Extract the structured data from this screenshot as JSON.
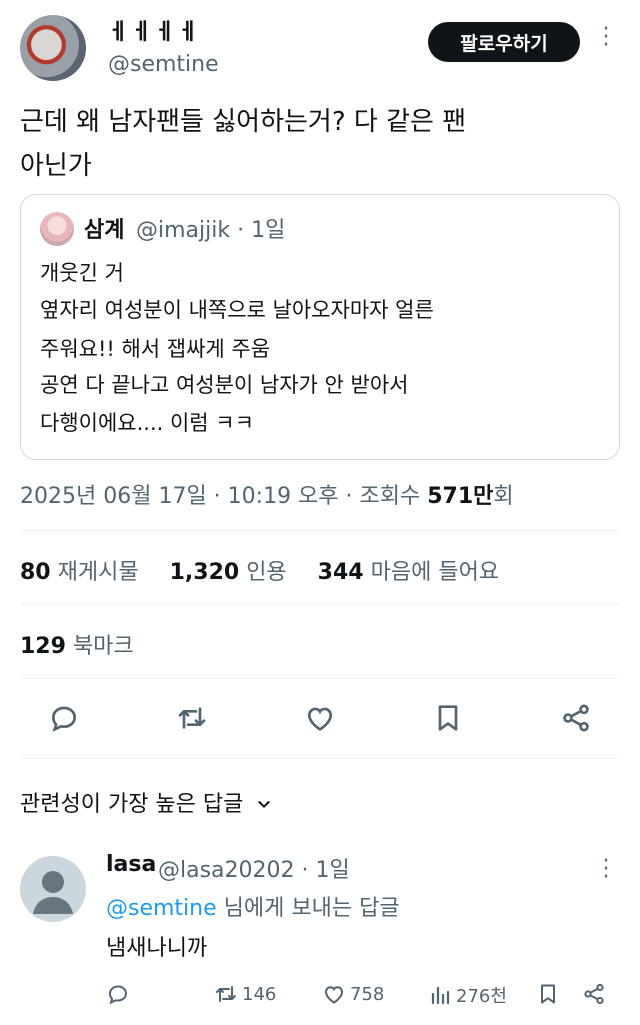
{
  "author": {
    "display_name": "ㅔㅔㅔㅔ",
    "handle": "@semtine",
    "follow_label": "팔로우하기",
    "more_icon": "ellipsis-vertical-icon"
  },
  "tweet": {
    "text_line1": "근데 왜 남자팬들 싫어하는거? 다 같은 팬",
    "text_line2": "아닌가"
  },
  "quote": {
    "name": "삼계",
    "meta": "@imajjik · 1일",
    "lines": [
      "개웃긴 거",
      "옆자리 여성분이 내쪽으로 날아오자마자 얼른",
      "주워요!! 해서 잽싸게 주움",
      "공연 다 끝나고 여성분이 남자가 안 받아서",
      "다행이에요.... 이럼 ㅋㅋ"
    ]
  },
  "timestamp": {
    "text": "2025년 06월 17일 · 10:19 오후 · 조회수 ",
    "views": "571만",
    "views_suffix": "회"
  },
  "stats": {
    "retweets_num": "80",
    "retweets_label": "재게시물",
    "quotes_num": "1,320",
    "quotes_label": "인용",
    "likes_num": "344",
    "likes_label": "마음에 들어요",
    "bookmarks_num": "129",
    "bookmarks_label": "북마크"
  },
  "actions": {
    "icons": [
      "reply-icon",
      "retweet-icon",
      "like-icon",
      "bookmark-icon",
      "share-icon"
    ],
    "icon_color": "#536471"
  },
  "replies_sort": {
    "label": "관련성이 가장 높은 답글"
  },
  "reply": {
    "name": "lasa",
    "meta": "@lasa20202 · 1일",
    "mention": "@semtine",
    "replying_suffix": " 님에게 보내는 답글",
    "text": "냄새나니까",
    "retweets": "146",
    "likes": "758",
    "views": "276천"
  },
  "colors": {
    "text": "#0f1419",
    "secondary": "#536471",
    "link": "#1d9bf0",
    "border": "#cfd9de",
    "button_bg": "#0f1419"
  }
}
